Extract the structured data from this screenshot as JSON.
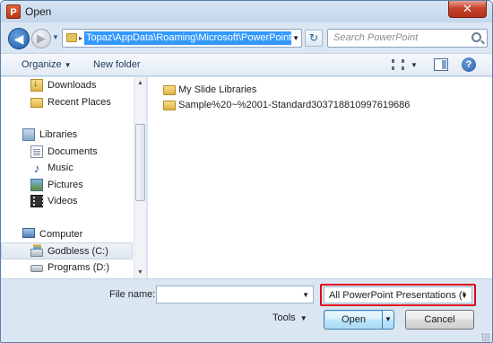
{
  "window": {
    "title": "Open",
    "app_icon_letter": "P",
    "close_glyph": "✕"
  },
  "navigation": {
    "back_glyph": "◀",
    "forward_glyph": "▶",
    "recent_glyph": "▼"
  },
  "address": {
    "path": "Topaz\\AppData\\Roaming\\Microsoft\\PowerPoint",
    "separator_glyph": "▸",
    "dropdown_glyph": "▼",
    "refresh_glyph": "↻"
  },
  "search": {
    "placeholder": "Search PowerPoint"
  },
  "toolbar": {
    "organize_label": "Organize",
    "organize_caret": "▼",
    "new_folder_label": "New folder",
    "view_caret": "▼",
    "help_glyph": "?"
  },
  "sidebar": {
    "items": [
      {
        "label": "Downloads",
        "icon": "downloads-icon"
      },
      {
        "label": "Recent Places",
        "icon": "recent-places-icon"
      },
      {
        "label": "Libraries",
        "icon": "libraries-icon"
      },
      {
        "label": "Documents",
        "icon": "documents-icon"
      },
      {
        "label": "Music",
        "icon": "music-icon",
        "glyph": "♪"
      },
      {
        "label": "Pictures",
        "icon": "pictures-icon"
      },
      {
        "label": "Videos",
        "icon": "videos-icon"
      },
      {
        "label": "Computer",
        "icon": "computer-icon"
      },
      {
        "label": "Godbless (C:)",
        "icon": "drive-c-icon",
        "selected": true
      },
      {
        "label": "Programs (D:)",
        "icon": "drive-d-icon"
      }
    ],
    "scroll_up_glyph": "▲",
    "scroll_down_glyph": "▼"
  },
  "files": {
    "items": [
      {
        "name": "My Slide Libraries",
        "icon": "folder-icon"
      },
      {
        "name": "Sample%20~%2001-Standard303718810997619686",
        "icon": "folder-icon"
      }
    ]
  },
  "bottom": {
    "file_name_label": "File name:",
    "file_name_value": "",
    "file_name_dropdown_glyph": "▼",
    "file_type_filter": "All PowerPoint Presentations (*",
    "file_type_dropdown_glyph": "▼",
    "tools_label": "Tools",
    "tools_caret": "▼",
    "open_label": "Open",
    "open_split_glyph": "▼",
    "cancel_label": "Cancel"
  },
  "colors": {
    "selection_blue": "#3399ff",
    "highlight_red": "#e0081c",
    "chrome_blue": "#dbe6f3"
  }
}
